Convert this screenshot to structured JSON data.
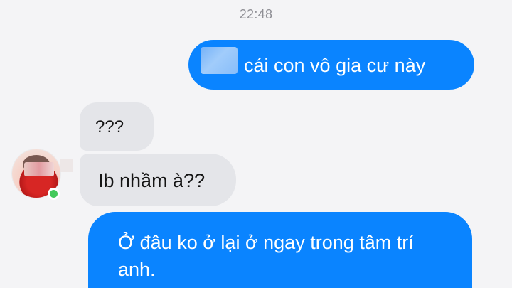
{
  "conversation": {
    "timestamp": "22:48",
    "messages": [
      {
        "direction": "outgoing",
        "text": "cái con vô gia cư này"
      },
      {
        "direction": "incoming",
        "text": "???"
      },
      {
        "direction": "incoming",
        "text": "Ib nhầm à??"
      },
      {
        "direction": "outgoing",
        "text": "Ở đâu ko ở lại ở ngay trong tâm trí anh."
      }
    ]
  },
  "colors": {
    "background": "#f4f4f6",
    "outgoing_bubble": "#0a84ff",
    "incoming_bubble": "#e4e5e9",
    "online_status": "#44c95b"
  },
  "icons": {
    "online_status": "online-status-icon"
  }
}
